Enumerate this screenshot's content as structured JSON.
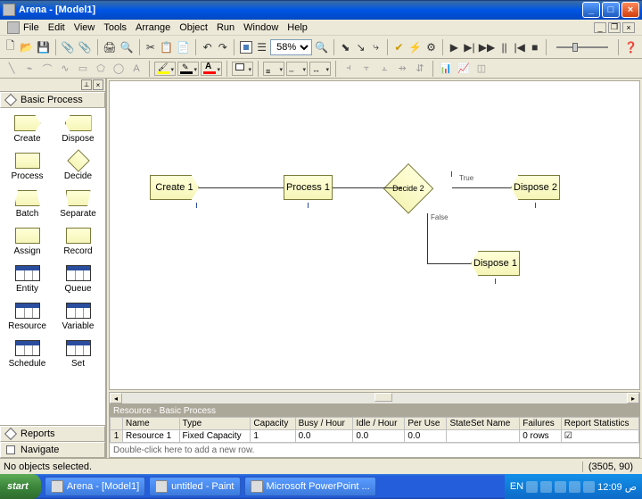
{
  "window": {
    "title": "Arena - [Model1]"
  },
  "menu": {
    "file": "File",
    "edit": "Edit",
    "view": "View",
    "tools": "Tools",
    "arrange": "Arrange",
    "object": "Object",
    "run": "Run",
    "window": "Window",
    "help": "Help"
  },
  "toolbar": {
    "zoom": "58%"
  },
  "sidebar": {
    "title": "Basic Process",
    "items": [
      {
        "label": "Create"
      },
      {
        "label": "Dispose"
      },
      {
        "label": "Process"
      },
      {
        "label": "Decide"
      },
      {
        "label": "Batch"
      },
      {
        "label": "Separate"
      },
      {
        "label": "Assign"
      },
      {
        "label": "Record"
      },
      {
        "label": "Entity"
      },
      {
        "label": "Queue"
      },
      {
        "label": "Resource"
      },
      {
        "label": "Variable"
      },
      {
        "label": "Schedule"
      },
      {
        "label": "Set"
      }
    ],
    "reports": "Reports",
    "navigate": "Navigate"
  },
  "flow": {
    "create1": "Create 1",
    "process1": "Process 1",
    "decide2": "Decide 2",
    "dispose2": "Dispose 2",
    "dispose1": "Dispose 1",
    "true_lbl": "True",
    "false_lbl": "False"
  },
  "grid": {
    "title": "Resource - Basic Process",
    "cols": {
      "name": "Name",
      "type": "Type",
      "capacity": "Capacity",
      "busy": "Busy / Hour",
      "idle": "Idle / Hour",
      "peruse": "Per Use",
      "stateset": "StateSet Name",
      "failures": "Failures",
      "report": "Report Statistics"
    },
    "row": {
      "num": "1",
      "name": "Resource 1",
      "type": "Fixed Capacity",
      "capacity": "1",
      "busy": "0.0",
      "idle": "0.0",
      "peruse": "0.0",
      "stateset": "",
      "failures": "0 rows",
      "report": "☑"
    },
    "hint": "Double-click here to add a new row."
  },
  "status": {
    "left": "No objects selected.",
    "right": "(3505, 90)"
  },
  "taskbar": {
    "start": "start",
    "tasks": [
      {
        "label": "Arena - [Model1]"
      },
      {
        "label": "untitled - Paint"
      },
      {
        "label": "Microsoft PowerPoint ..."
      }
    ],
    "lang": "EN",
    "clock": "12:09 ص"
  }
}
